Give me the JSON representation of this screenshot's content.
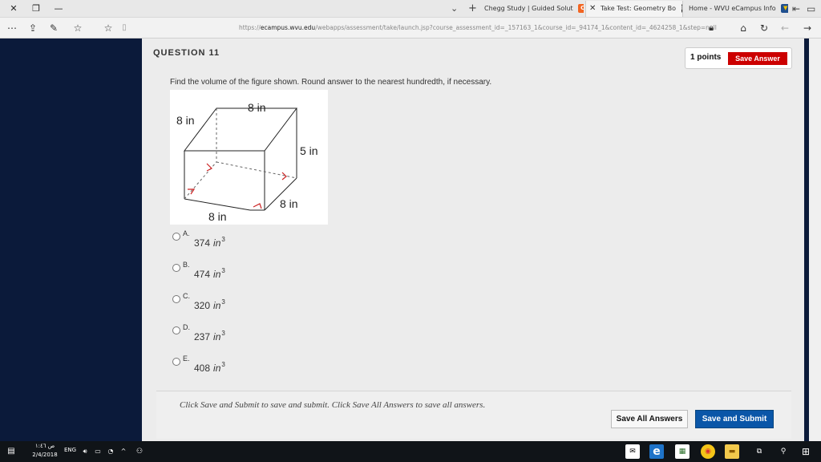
{
  "browser": {
    "tabs": [
      {
        "label": "Chegg Study | Guided Solut",
        "icon_letter": "C",
        "icon_color": "#f26522"
      },
      {
        "label": "Take Test: Geometry Bo",
        "icon_letter": "Bb",
        "icon_color": "#222222"
      },
      {
        "label": "Home - WVU eCampus Info",
        "icon_letter": "",
        "icon_color": "#1f4f8f"
      }
    ],
    "url_prefix": "https://",
    "url_domain": "ecampus.wvu.edu",
    "url_path": "/webapps/assessment/take/launch.jsp?course_assessment_id=_157163_1&course_id=_94174_1&content_id=_4624258_1&step=null"
  },
  "question": {
    "title": "QUESTION 11",
    "points": "1 points",
    "save_answer_label": "Save Answer",
    "prompt": "Find the volume of the figure shown. Round answer to the nearest hundredth, if necessary.",
    "figure_labels": {
      "top": "8 in",
      "left": "8 in",
      "right_height": "5 in",
      "bottom_depth": "8 in",
      "bottom_width": "8 in"
    },
    "options": [
      {
        "letter": "A.",
        "value": "374",
        "unit": "in",
        "exp": "3"
      },
      {
        "letter": "B.",
        "value": "474",
        "unit": "in",
        "exp": "3"
      },
      {
        "letter": "C.",
        "value": "320",
        "unit": "in",
        "exp": "3"
      },
      {
        "letter": "D.",
        "value": "237",
        "unit": "in",
        "exp": "3"
      },
      {
        "letter": "E.",
        "value": "408",
        "unit": "in",
        "exp": "3"
      }
    ]
  },
  "footer": {
    "text": "Click Save and Submit to save and submit. Click Save All Answers to save all answers.",
    "save_all_label": "Save All Answers",
    "save_submit_label": "Save and Submit"
  },
  "taskbar": {
    "time": "ص ١:٤٦",
    "date": "2/4/2018",
    "lang": "ENG"
  },
  "colors": {
    "side_panel": "#0b1a3a",
    "save_answer": "#cc0000",
    "submit_blue": "#0a56a8"
  }
}
